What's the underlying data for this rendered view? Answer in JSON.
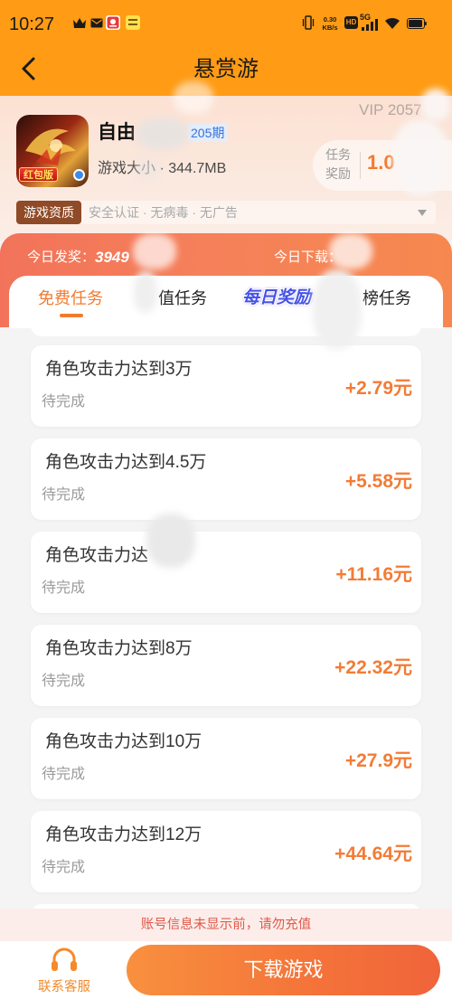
{
  "status_bar": {
    "time": "10:27",
    "net_speed": "0.30",
    "net_speed_unit": "KB/s",
    "hd_label": "HD",
    "network_label": "5G",
    "left_icons": [
      "crown-icon",
      "mail-icon",
      "red-app-icon",
      "yellow-app-icon"
    ],
    "right_icons": [
      "vibrate-icon",
      "signal-icon",
      "wifi-icon",
      "battery-icon"
    ]
  },
  "header": {
    "title": "悬赏游",
    "back_icon": "back-arrow-icon"
  },
  "game": {
    "name_visible": "自由",
    "period": "205期",
    "vip": "VIP 2057",
    "icon_badge": "红包版",
    "size_label": "游戏大小",
    "size_separator": "·",
    "size_value": "344.7MB",
    "reward_label_top": "任务",
    "reward_label_bottom": "奖励",
    "reward_value_visible": "1.0"
  },
  "qualification": {
    "badge": "游戏资质",
    "items": "安全认证 · 无病毒 · 无广告",
    "expand_icon": "caret-down-icon"
  },
  "stats": {
    "award_label": "今日发奖：",
    "award_value": "3949",
    "download_label": "今日下载："
  },
  "tabs": [
    {
      "label": "免费任务",
      "active": true
    },
    {
      "label": "值任务",
      "active": false
    },
    {
      "label": "每日奖励",
      "active": false
    },
    {
      "label": "榜任务",
      "active": false
    }
  ],
  "tasks": [
    {
      "title": "角色攻击力达到3万",
      "status": "待完成",
      "reward": "+2.79元"
    },
    {
      "title": "角色攻击力达到4.5万",
      "status": "待完成",
      "reward": "+5.58元"
    },
    {
      "title": "角色攻击力达",
      "status": "待完成",
      "reward": "+11.16元"
    },
    {
      "title": "角色攻击力达到8万",
      "status": "待完成",
      "reward": "+22.32元"
    },
    {
      "title": "角色攻击力达到10万",
      "status": "待完成",
      "reward": "+27.9元"
    },
    {
      "title": "角色攻击力达到12万",
      "status": "待完成",
      "reward": "+44.64元"
    }
  ],
  "notice": "账号信息未显示前，请勿充值",
  "footer": {
    "service_label": "联系客服",
    "service_icon": "headset-icon",
    "download_button": "下载游戏"
  },
  "colors": {
    "header_bg": "#FF9B14",
    "accent": "#F27A2E",
    "reward_text": "#F27C36",
    "period_text": "#3571D8",
    "notice_text": "#E05A4A",
    "qualification_badge": "#8F4A27"
  }
}
